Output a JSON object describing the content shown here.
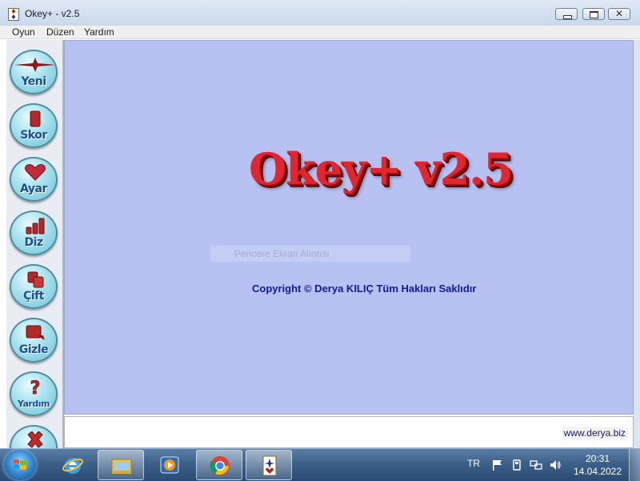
{
  "window": {
    "title": "Okey+ - v2.5",
    "close_glyph": "✕"
  },
  "menu": {
    "items": [
      {
        "label": "Oyun"
      },
      {
        "label": "Düzen"
      },
      {
        "label": "Yardım"
      }
    ]
  },
  "sidebar": {
    "buttons": [
      {
        "label": "Yeni",
        "icon": "star-icon"
      },
      {
        "label": "Skor",
        "icon": "tile-icon"
      },
      {
        "label": "Ayar",
        "icon": "heart-icon"
      },
      {
        "label": "Diz",
        "icon": "bars-icon"
      },
      {
        "label": "Çift",
        "icon": "pair-tiles-icon"
      },
      {
        "label": "Gizle",
        "icon": "hide-tile-icon"
      },
      {
        "label": "Yardım",
        "icon": "question-icon"
      },
      {
        "label": "",
        "icon": "close-x-icon"
      }
    ]
  },
  "main": {
    "title": "Okey+ v2.5",
    "overlay_label": "Pencere Ekran Alıntısı",
    "copyright": "Copyright © Derya KILIÇ Tüm Hakları Saklıdır",
    "background_color": "#b8c2f2",
    "title_color": "#e0262e",
    "copyright_color": "#101a9a"
  },
  "status": {
    "website": "www.derya.biz"
  },
  "taskbar": {
    "pinned": [
      {
        "name": "internet-explorer-icon"
      },
      {
        "name": "file-explorer-icon"
      },
      {
        "name": "media-player-icon"
      },
      {
        "name": "chrome-icon"
      },
      {
        "name": "okey-app-icon"
      }
    ],
    "language": "TR",
    "time": "20:31",
    "date": "14.04.2022"
  }
}
